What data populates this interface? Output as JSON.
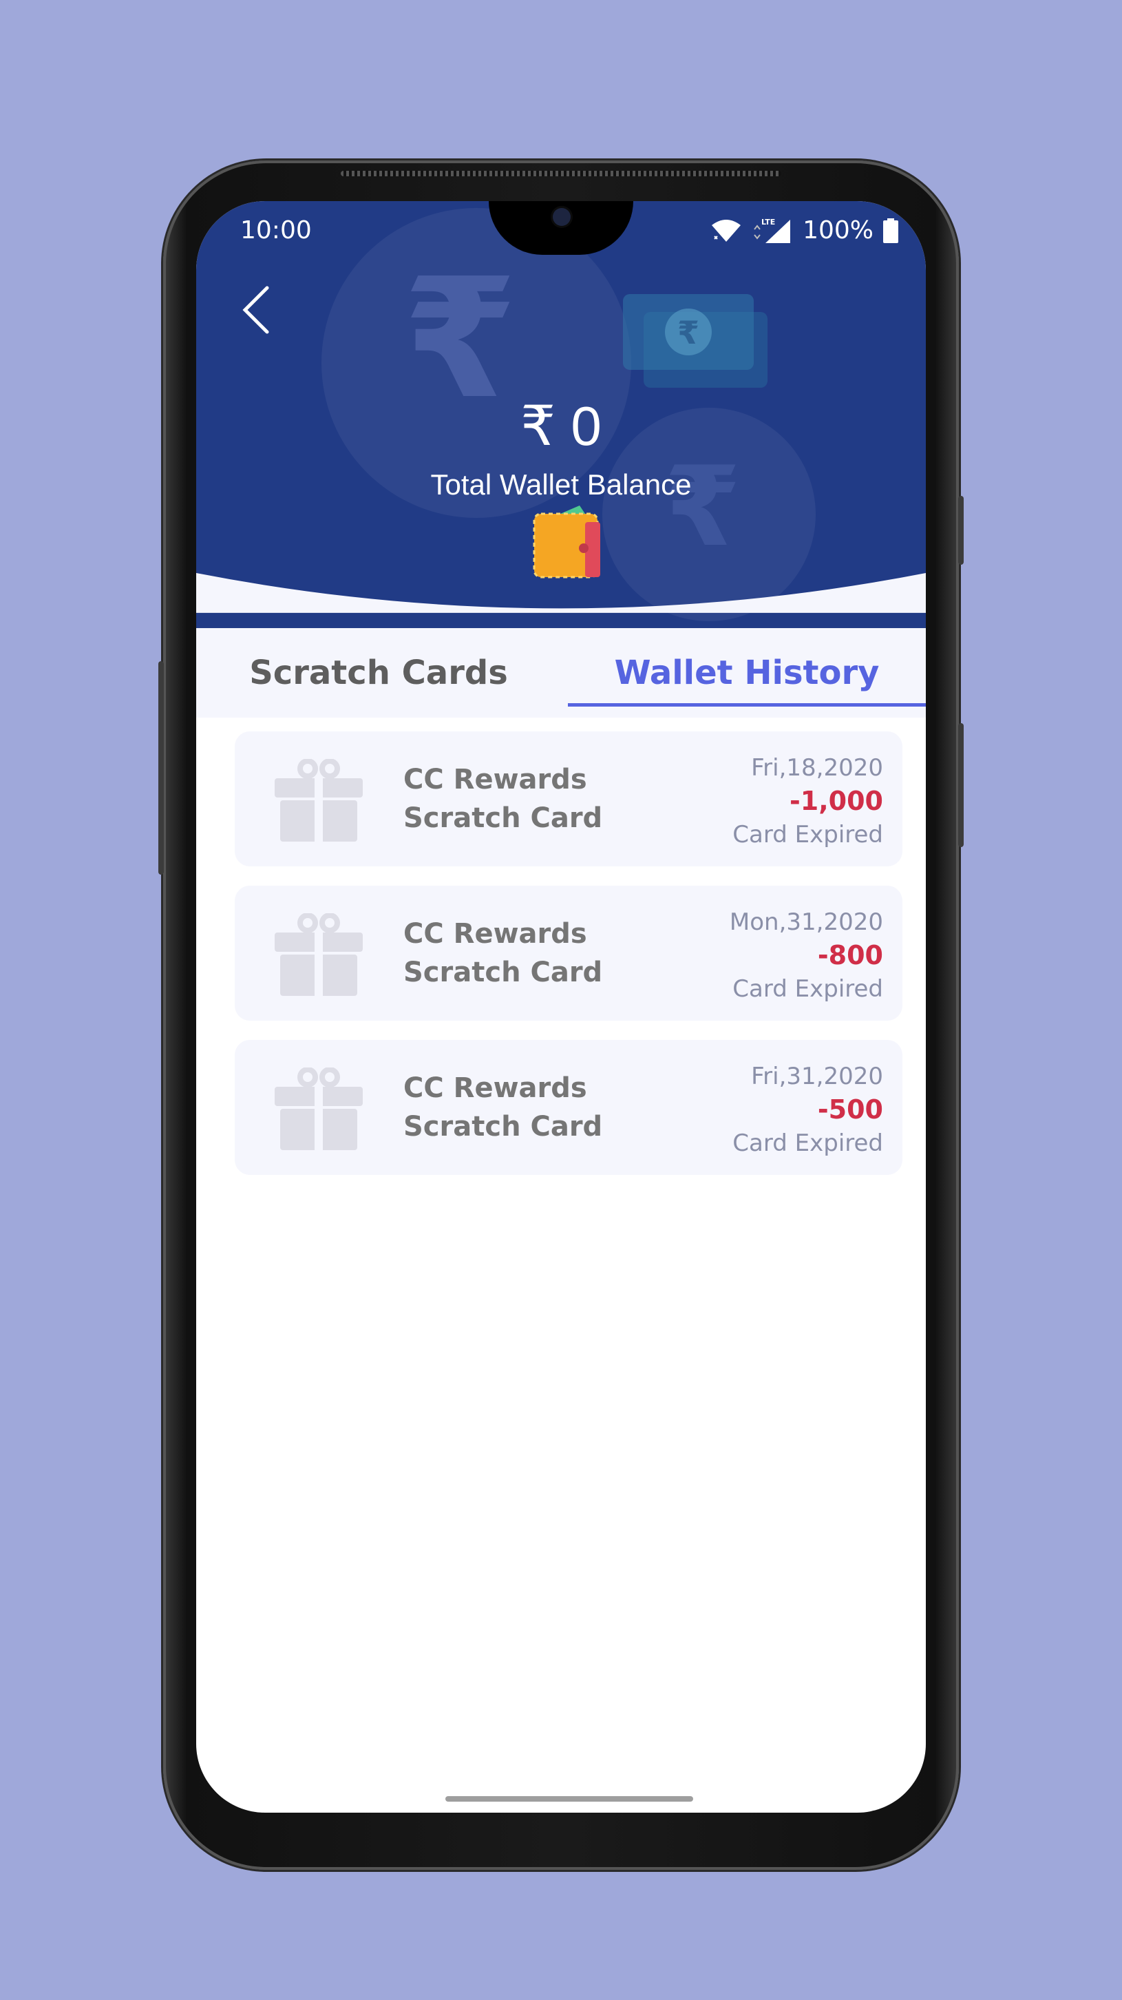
{
  "status_bar": {
    "time": "10:00",
    "network_label": "LTE",
    "battery": "100%"
  },
  "header": {
    "balance": "₹ 0",
    "balance_label": "Total Wallet Balance",
    "background_color": "#213b86"
  },
  "tabs": [
    {
      "label": "Scratch Cards",
      "active": false
    },
    {
      "label": "Wallet History",
      "active": true
    }
  ],
  "accent_color": "#5664e0",
  "history": [
    {
      "title_line1": "CC Rewards",
      "title_line2": "Scratch Card",
      "date": "Fri,18,2020",
      "amount": "-1,000",
      "status": "Card Expired"
    },
    {
      "title_line1": "CC Rewards",
      "title_line2": "Scratch Card",
      "date": "Mon,31,2020",
      "amount": "-800",
      "status": "Card Expired"
    },
    {
      "title_line1": "CC Rewards",
      "title_line2": "Scratch Card",
      "date": "Fri,31,2020",
      "amount": "-500",
      "status": "Card Expired"
    }
  ],
  "amount_color": "#d02e48"
}
